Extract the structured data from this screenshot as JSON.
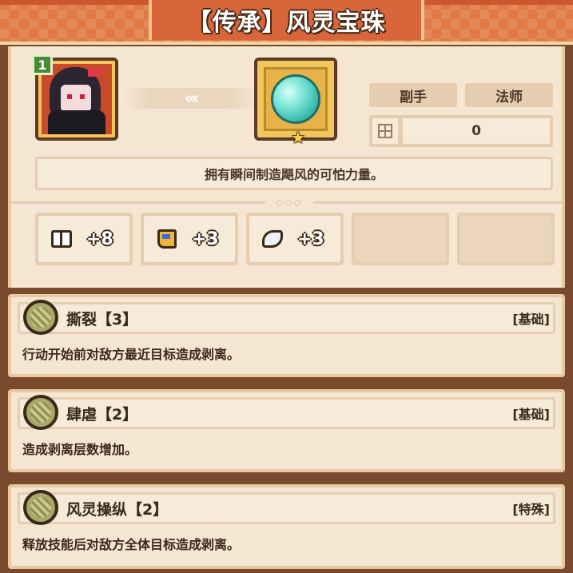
{
  "title": "【传承】风灵宝珠",
  "character": {
    "level": "1"
  },
  "item": {
    "tags": [
      "副手",
      "法师"
    ],
    "stat_value": "0",
    "description": "拥有瞬间制造飓风的可怕力量。"
  },
  "arrow_glyph": "‹‹‹",
  "bonuses": [
    {
      "icon": "book-icon",
      "value": "+8"
    },
    {
      "icon": "boot-icon",
      "value": "+3"
    },
    {
      "icon": "wing-icon",
      "value": "+3"
    }
  ],
  "skills": [
    {
      "name": "撕裂【3】",
      "type": "[基础]",
      "desc": "行动开始前对敌方最近目标造成剥离。"
    },
    {
      "name": "肆虐【2】",
      "type": "[基础]",
      "desc": "造成剥离层数增加。"
    },
    {
      "name": "风灵操纵【2】",
      "type": "[特殊]",
      "desc": "释放技能后对敌方全体目标造成剥离。"
    }
  ],
  "colors": {
    "title_bar": "#e07a45",
    "panel": "#f4e6d2",
    "frame": "#7a4a2e",
    "orb": "#3bbcb0"
  }
}
